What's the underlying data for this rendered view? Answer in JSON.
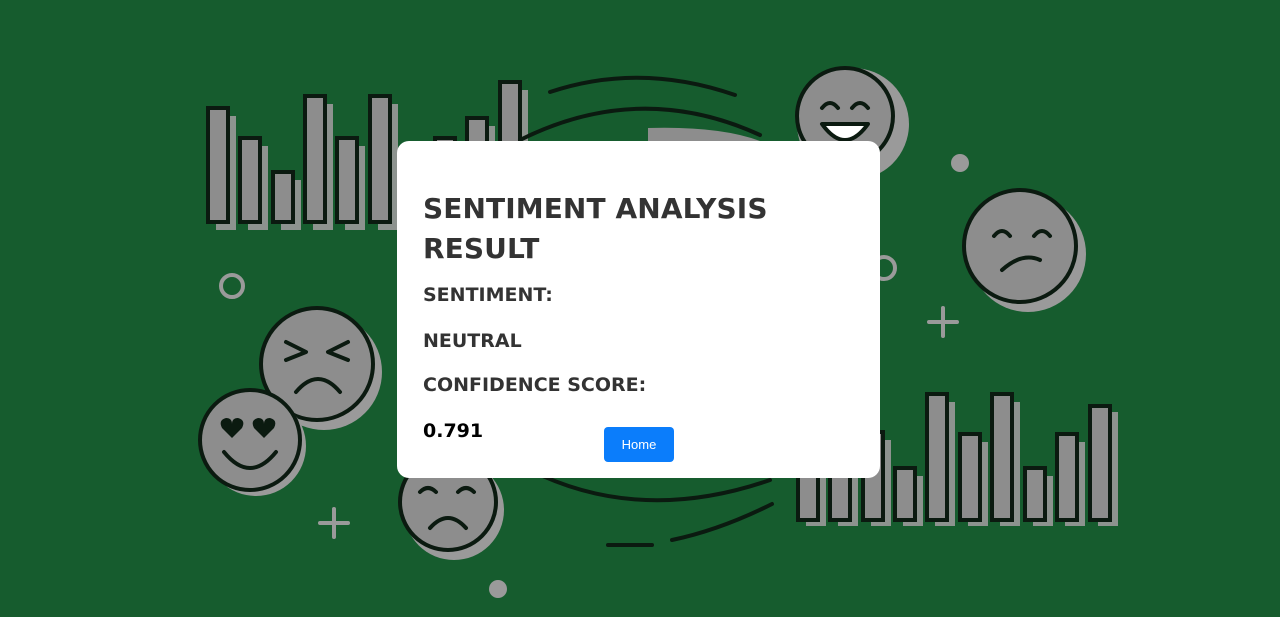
{
  "colors": {
    "background": "#165c2e",
    "illustration_gray": "#8d8d8d",
    "illustration_line": "#0b1a10",
    "card_bg": "#ffffff",
    "text_dark": "#333333",
    "button_bg": "#0b7dfb"
  },
  "result": {
    "title": "SENTIMENT ANALYSIS RESULT",
    "sentiment_label": "SENTIMENT:",
    "sentiment_value": "NEUTRAL",
    "confidence_label": "CONFIDENCE SCORE:",
    "confidence_value": "0.791"
  },
  "actions": {
    "home_label": "Home"
  },
  "background_icons": [
    "bar-chart-icon",
    "bar-chart-icon",
    "laughing-face-icon",
    "frown-face-icon",
    "angry-face-icon",
    "heart-eyes-face-icon",
    "sad-face-icon",
    "donut-chart-icon",
    "plus-icon",
    "ring-icon",
    "dot-icon"
  ]
}
